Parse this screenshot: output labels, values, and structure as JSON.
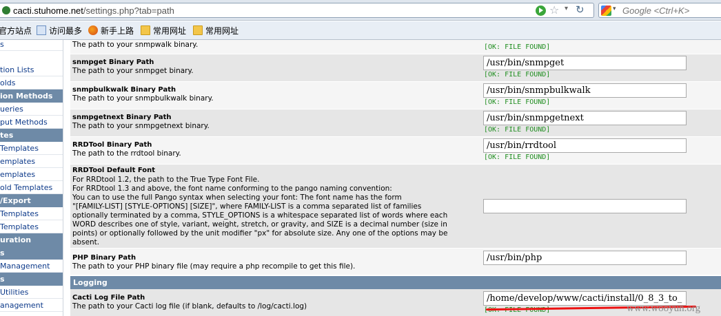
{
  "browser": {
    "url_host": "cacti.stuhome.net",
    "url_path": "/settings.php?tab=path",
    "search_placeholder": "Google <Ctrl+K>",
    "bookmarks": [
      "官方站点",
      "访问最多",
      "新手上路",
      "常用网址",
      "常用网址"
    ]
  },
  "leftnav": {
    "items": [
      {
        "label": "s",
        "kind": "link"
      },
      {
        "label": "tion Lists",
        "kind": "link"
      },
      {
        "label": "olds",
        "kind": "link"
      },
      {
        "label": "ion Methods",
        "kind": "head"
      },
      {
        "label": "ueries",
        "kind": "link"
      },
      {
        "label": "put Methods",
        "kind": "link"
      },
      {
        "label": "tes",
        "kind": "head"
      },
      {
        "label": " Templates",
        "kind": "link"
      },
      {
        "label": "emplates",
        "kind": "link"
      },
      {
        "label": "emplates",
        "kind": "link"
      },
      {
        "label": "old Templates",
        "kind": "link"
      },
      {
        "label": "/Export",
        "kind": "head"
      },
      {
        "label": " Templates",
        "kind": "link"
      },
      {
        "label": " Templates",
        "kind": "link"
      },
      {
        "label": "uration",
        "kind": "head"
      },
      {
        "label": "s",
        "kind": "head"
      },
      {
        "label": " Management",
        "kind": "link"
      },
      {
        "label": "s",
        "kind": "head"
      },
      {
        "label": " Utilities",
        "kind": "link"
      },
      {
        "label": "anagement",
        "kind": "link"
      }
    ]
  },
  "settings": {
    "snmpwalk": {
      "desc": "The path to your snmpwalk binary.",
      "status": "[OK: FILE FOUND]"
    },
    "snmpget": {
      "title": "snmpget Binary Path",
      "desc": "The path to your snmpget binary.",
      "value": "/usr/bin/snmpget",
      "status": "[OK: FILE FOUND]"
    },
    "snmpbulkwalk": {
      "title": "snmpbulkwalk Binary Path",
      "desc": "The path to your snmpbulkwalk binary.",
      "value": "/usr/bin/snmpbulkwalk",
      "status": "[OK: FILE FOUND]"
    },
    "snmpgetnext": {
      "title": "snmpgetnext Binary Path",
      "desc": "The path to your snmpgetnext binary.",
      "value": "/usr/bin/snmpgetnext",
      "status": "[OK: FILE FOUND]"
    },
    "rrdtool": {
      "title": "RRDTool Binary Path",
      "desc": "The path to the rrdtool binary.",
      "value": "/usr/bin/rrdtool",
      "status": "[OK: FILE FOUND]"
    },
    "rrdfont": {
      "title": "RRDTool Default Font",
      "desc_lines": [
        "For RRDtool 1.2, the path to the True Type Font File.",
        "For RRDtool 1.3 and above, the font name conforming to the pango naming convention:",
        "You can to use the full Pango syntax when selecting your font: The font name has the form",
        "\"[FAMILY-LIST] [STYLE-OPTIONS] [SIZE]\", where FAMILY-LIST is a comma separated list of families",
        "optionally terminated by a comma, STYLE_OPTIONS is a whitespace separated list of words where each",
        "WORD describes one of style, variant, weight, stretch, or gravity, and SIZE is a decimal number (size in",
        "points) or optionally followed by the unit modifier \"px\" for absolute size. Any one of the options may be",
        "absent."
      ],
      "value": ""
    },
    "php": {
      "title": "PHP Binary Path",
      "desc": "The path to your PHP binary file (may require a php recompile to get this file).",
      "value": "/usr/bin/php"
    },
    "logging_header": "Logging",
    "cactilog": {
      "title": "Cacti Log File Path",
      "desc": "The path to your Cacti log file (if blank, defaults to /log/cacti.log)",
      "value": "/home/develop/www/cacti/install/0_8_3_to_",
      "status": "[OK: FILE FOUND]"
    }
  },
  "watermark": "www.wooyun.org",
  "colors": {
    "section_header": "#6e8aa7",
    "status_ok": "#1f8d1f",
    "row_light": "#f5f5f5",
    "row_dark": "#e6e6e6",
    "annotation_line": "#e11111"
  }
}
